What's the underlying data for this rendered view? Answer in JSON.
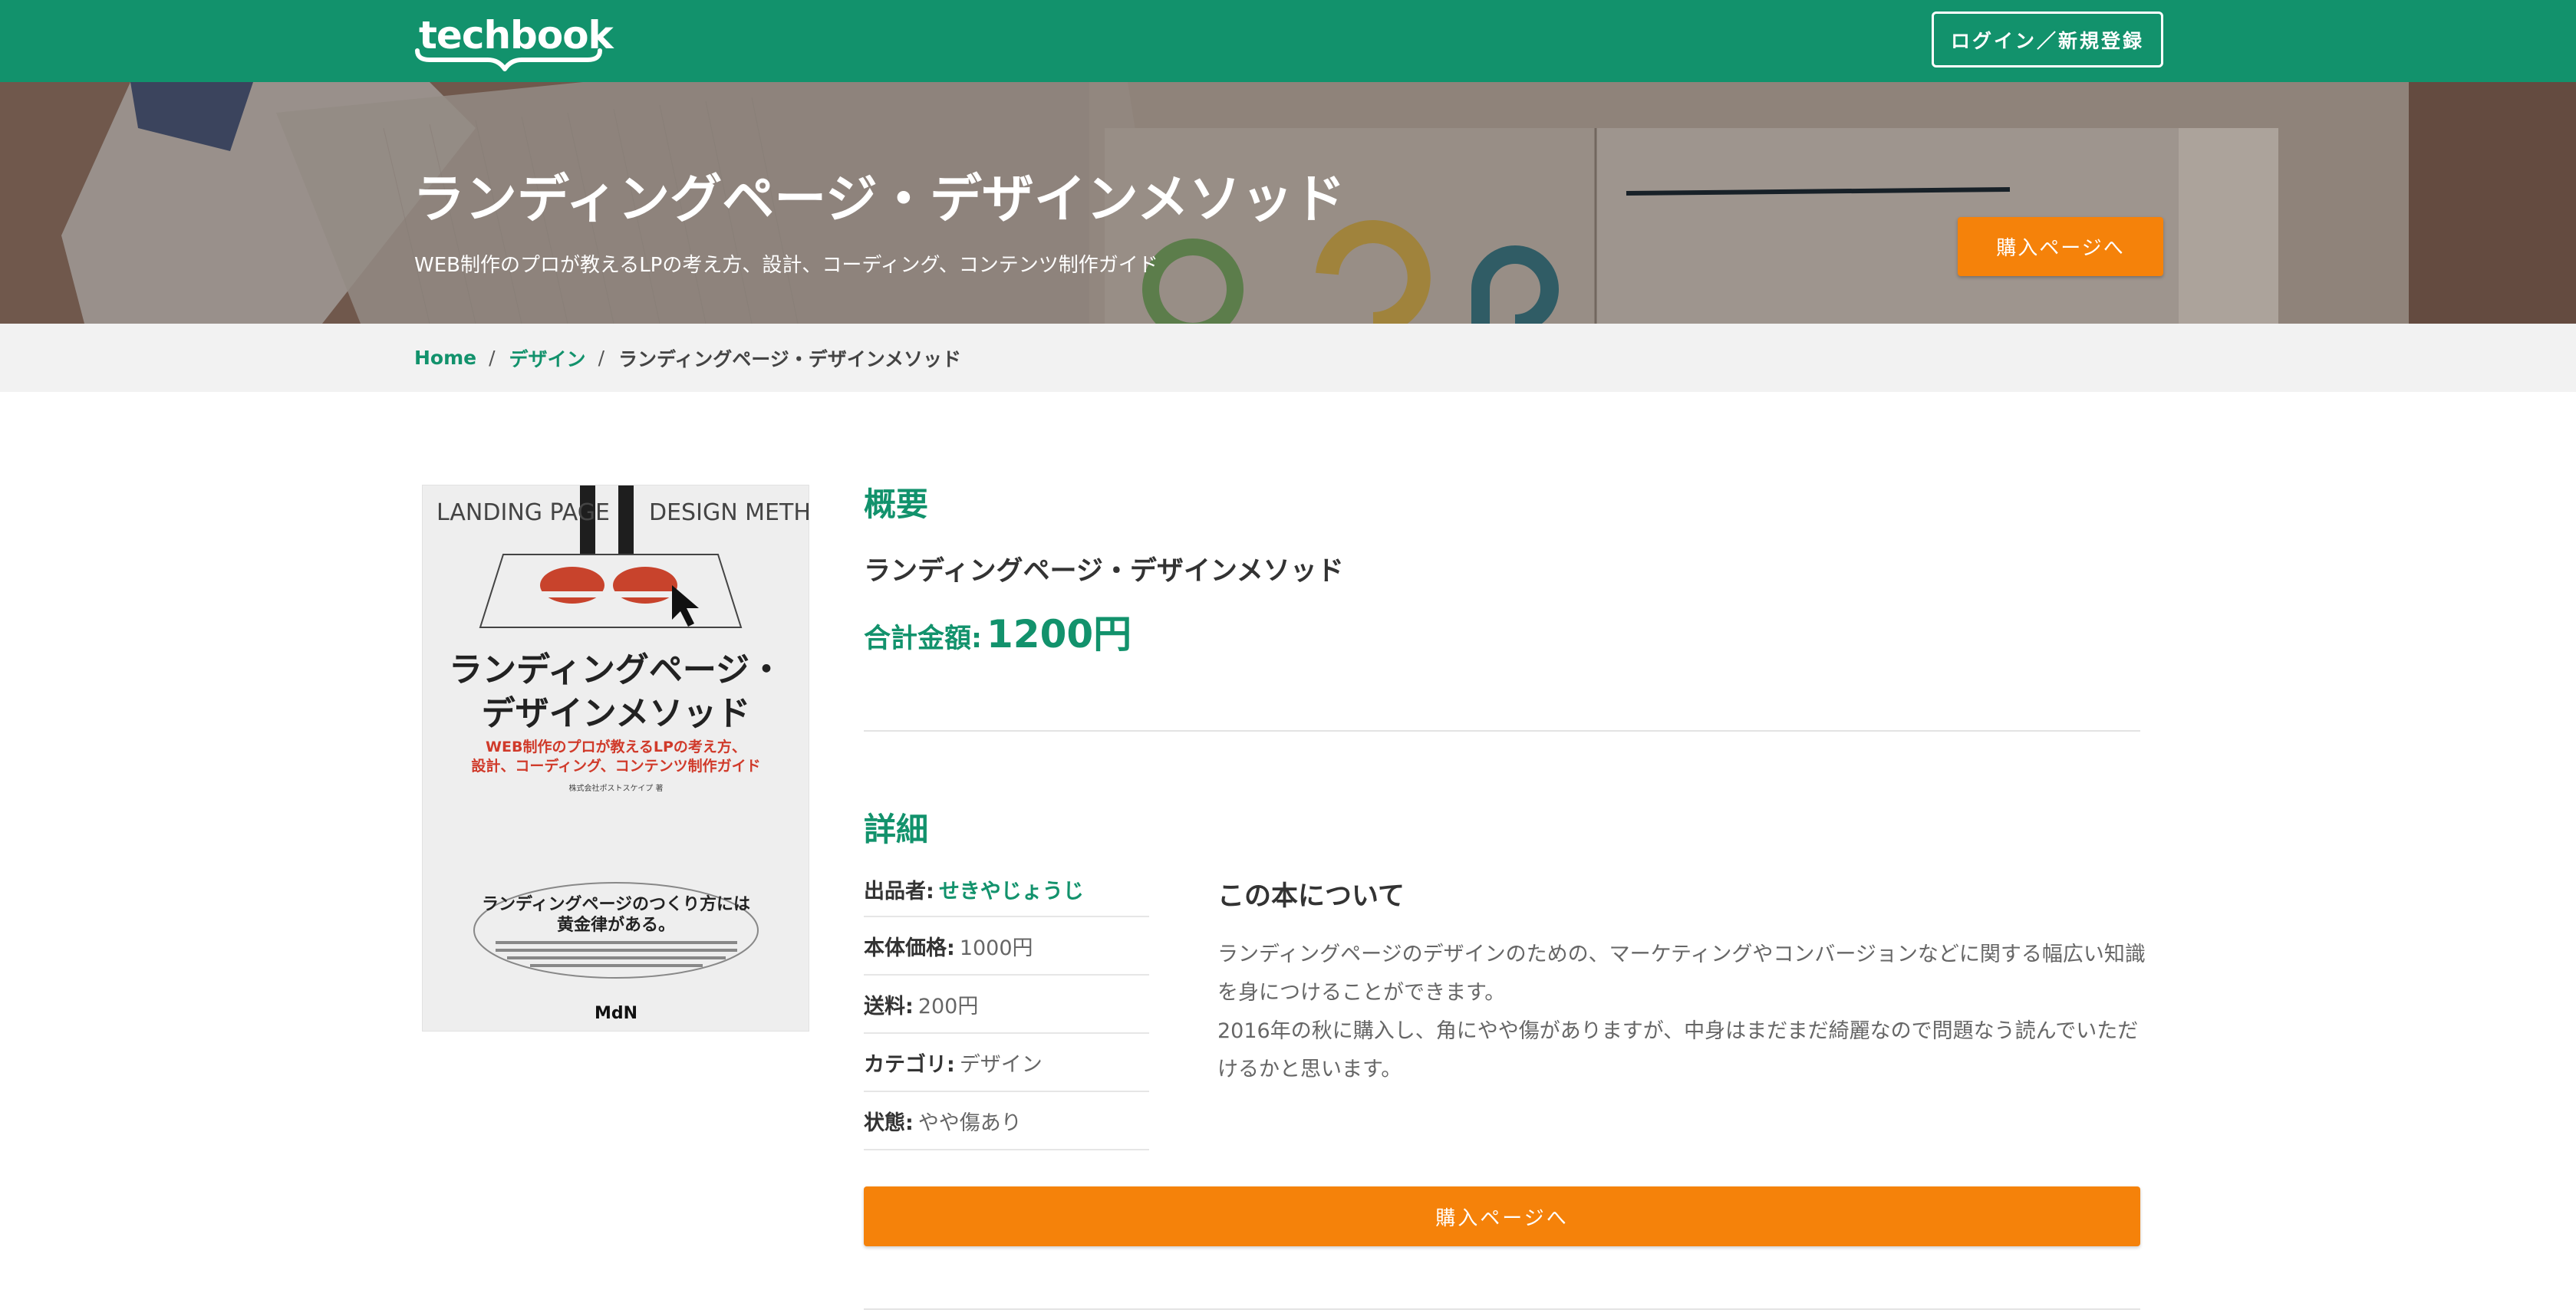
{
  "header": {
    "logo_text": "techbook",
    "login_label": "ログイン／新規登録"
  },
  "hero": {
    "title": "ランディングページ・デザインメソッド",
    "subtitle": "WEB制作のプロが教えるLPの考え方、設計、コーディング、コンテンツ制作ガイド",
    "buy_label": "購入ページへ"
  },
  "breadcrumb": {
    "home": "Home",
    "category": "デザイン",
    "current": "ランディングページ・デザインメソッド",
    "separator": "/"
  },
  "cover": {
    "top_left": "LANDING PAGE",
    "top_right": "DESIGN METHOD",
    "title_line1": "ランディングページ・",
    "title_line2": "デザインメソッド",
    "subtitle_line1": "WEB制作のプロが教えるLPの考え方、",
    "subtitle_line2": "設計、コーディング、コンテンツ制作ガイド",
    "author": "株式会社ポストスケイプ 著",
    "tagline_line1": "ランディングページのつくり方には",
    "tagline_line2": "黄金律がある。",
    "publisher": "MdN"
  },
  "overview": {
    "heading": "概要",
    "book_name": "ランディングページ・デザインメソッド",
    "price_label": "合計金額:",
    "price_value": "1200円"
  },
  "details": {
    "heading": "詳細",
    "seller_label": "出品者:",
    "seller_name": "せきやじょうじ",
    "list_price_label": "本体価格:",
    "list_price_value": "1000円",
    "shipping_label": "送料:",
    "shipping_value": "200円",
    "category_label": "カテゴリ:",
    "category_value": "デザイン",
    "condition_label": "状態:",
    "condition_value": "やや傷あり"
  },
  "about": {
    "heading": "この本について",
    "paragraph1": "ランディングページのデザインのための、マーケティングやコンバージョンなどに関する幅広い知識を身につけることができます。",
    "paragraph2": "2016年の秋に購入し、角にやや傷がありますが、中身はまだまだ綺麗なので問題なう読んでいただけるかと思います。"
  },
  "purchase": {
    "buy_label": "購入ページへ"
  },
  "colors": {
    "brand_green": "#12926c",
    "accent_orange": "#f5820a",
    "breadcrumb_bg": "#f2f2f2"
  }
}
